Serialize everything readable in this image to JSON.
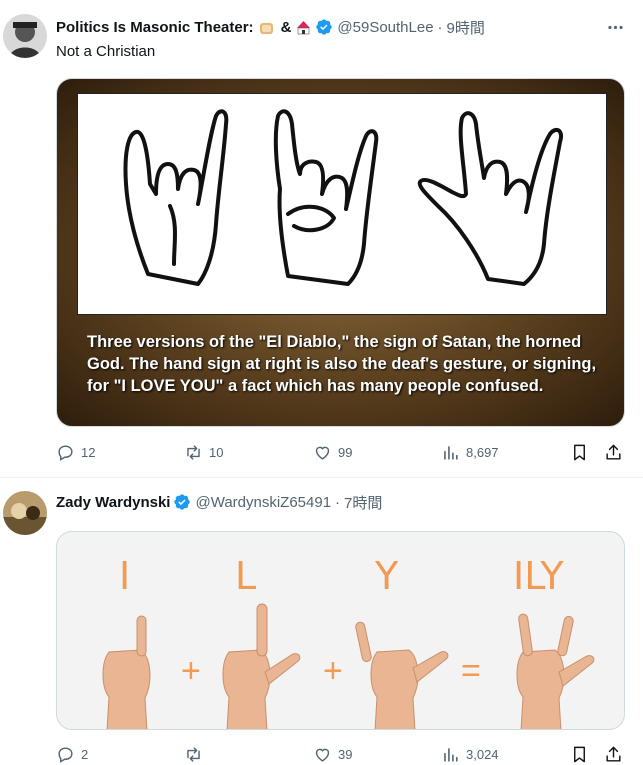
{
  "tweets": [
    {
      "display_name": "Politics Is Masonic Theater:",
      "amp": "&",
      "handle": "@59SouthLee",
      "time": "9時間",
      "text": "Not a Christian",
      "image_caption": "Three versions of the \"El Diablo,\" the sign of Satan, the horned God. The hand sign at right is also the deaf's gesture, or signing, for \"I LOVE YOU\" a fact which has many people confused.",
      "replies": "12",
      "retweets": "10",
      "likes": "99",
      "views": "8,697"
    },
    {
      "display_name": "Zady Wardynski",
      "handle": "@WardynskiZ65491",
      "time": "7時間",
      "image_letters": [
        "I",
        "L",
        "Y",
        "ILY"
      ],
      "image_operators": [
        "+",
        "+",
        "="
      ],
      "replies": "2",
      "retweets": "",
      "likes": "39",
      "views": "3,024"
    }
  ],
  "icons": {
    "more": "more-icon",
    "verified": "verified-badge-icon",
    "reply": "reply-icon",
    "retweet": "retweet-icon",
    "like": "heart-icon",
    "views": "views-icon",
    "bookmark": "bookmark-icon",
    "share": "share-icon"
  },
  "colors": {
    "verified": "#1d9bf0",
    "muted": "#536471",
    "asl_orange": "#f39a52"
  },
  "dot": "·"
}
